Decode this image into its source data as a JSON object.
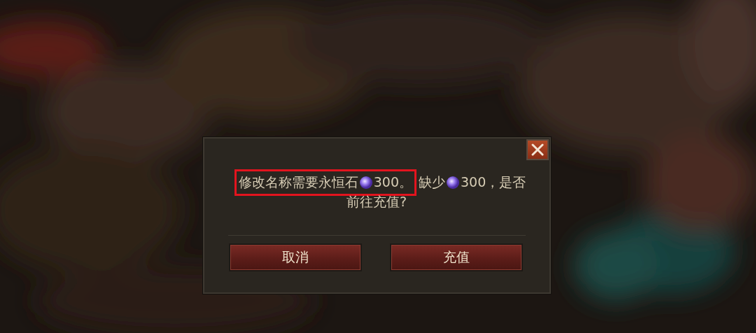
{
  "dialog": {
    "message": {
      "line_1": [
        {
          "kind": "text",
          "text": "修改名称需要永恒石",
          "highlighted": true
        },
        {
          "kind": "gem",
          "highlighted": true
        },
        {
          "kind": "text",
          "text": "300。",
          "highlighted": true
        },
        {
          "kind": "text",
          "text": "缺少",
          "highlighted": false
        },
        {
          "kind": "gem",
          "highlighted": false
        },
        {
          "kind": "text",
          "text": "300，是否",
          "highlighted": false
        }
      ],
      "line_2": "前往充值?"
    },
    "buttons": [
      {
        "label": "取消"
      },
      {
        "label": "充值"
      }
    ]
  }
}
